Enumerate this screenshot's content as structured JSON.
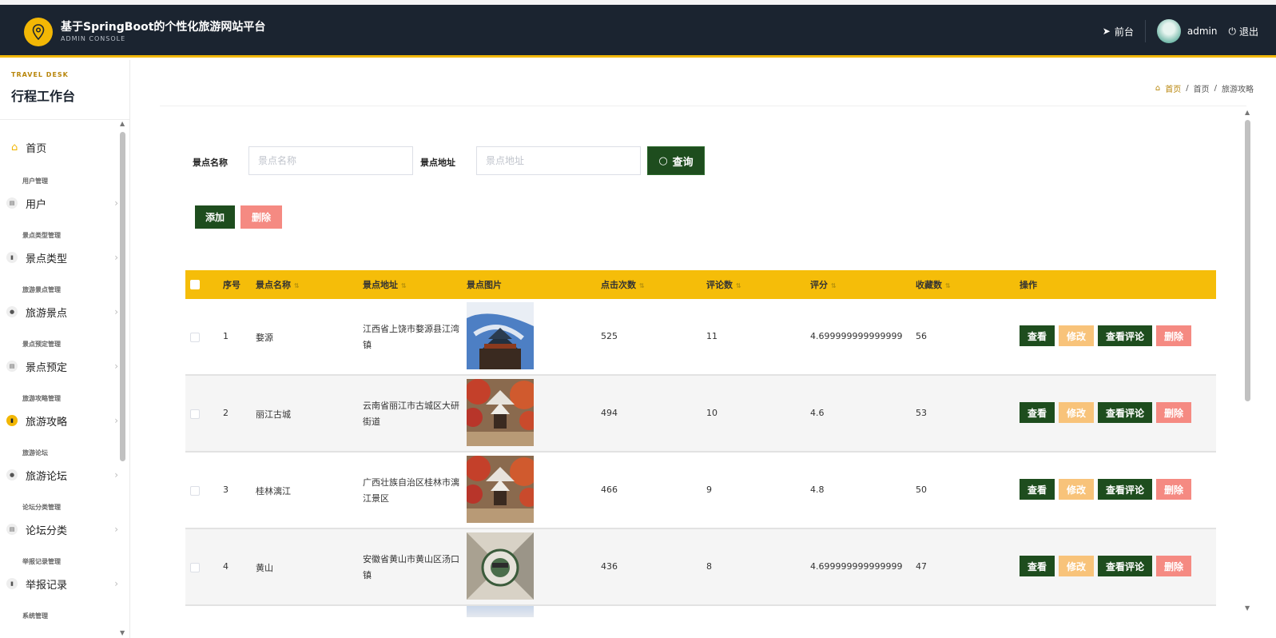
{
  "header": {
    "title": "基于SpringBoot的个性化旅游网站平台",
    "subtitle": "ADMIN CONSOLE",
    "front_label": "前台",
    "user_name": "admin",
    "logout_label": "退出"
  },
  "sidebar": {
    "kicker": "TRAVEL DESK",
    "title": "行程工作台",
    "home_label": "首页",
    "groups": [
      {
        "group": "用户管理",
        "item": "用户"
      },
      {
        "group": "景点类型管理",
        "item": "景点类型"
      },
      {
        "group": "旅游景点管理",
        "item": "旅游景点"
      },
      {
        "group": "景点预定管理",
        "item": "景点预定"
      },
      {
        "group": "旅游攻略管理",
        "item": "旅游攻略",
        "active": true
      },
      {
        "group": "旅游论坛",
        "item": "旅游论坛"
      },
      {
        "group": "论坛分类管理",
        "item": "论坛分类"
      },
      {
        "group": "举报记录管理",
        "item": "举报记录"
      },
      {
        "group": "系统管理",
        "item": ""
      }
    ]
  },
  "breadcrumb": [
    "首页",
    "首页",
    "旅游攻略"
  ],
  "search": {
    "name_label": "景点名称",
    "name_placeholder": "景点名称",
    "address_label": "景点地址",
    "address_placeholder": "景点地址",
    "query_label": "查询"
  },
  "actions": {
    "add_label": "添加",
    "delete_label": "删除"
  },
  "table": {
    "headers": [
      "序号",
      "景点名称",
      "景点地址",
      "景点图片",
      "点击次数",
      "评论数",
      "评分",
      "收藏数",
      "操作"
    ],
    "rows": [
      {
        "no": "1",
        "name": "婺源",
        "address": "江西省上饶市婺源县江湾镇",
        "clicks": "525",
        "comments": "11",
        "score": "4.699999999999999",
        "favorites": "56"
      },
      {
        "no": "2",
        "name": "丽江古城",
        "address": "云南省丽江市古城区大研街道",
        "clicks": "494",
        "comments": "10",
        "score": "4.6",
        "favorites": "53"
      },
      {
        "no": "3",
        "name": "桂林漓江",
        "address": "广西壮族自治区桂林市漓江景区",
        "clicks": "466",
        "comments": "9",
        "score": "4.8",
        "favorites": "50"
      },
      {
        "no": "4",
        "name": "黄山",
        "address": "安徽省黄山市黄山区汤口镇",
        "clicks": "436",
        "comments": "8",
        "score": "4.699999999999999",
        "favorites": "47"
      }
    ],
    "op_labels": {
      "view": "查看",
      "edit": "修改",
      "comments": "查看评论",
      "delete": "删除"
    }
  },
  "colors": {
    "header_bg": "#1b2430",
    "accent": "#f2b705",
    "primary_btn": "#1e4d1e",
    "danger_btn": "#f58a82",
    "warning_btn": "#f8c37a"
  }
}
